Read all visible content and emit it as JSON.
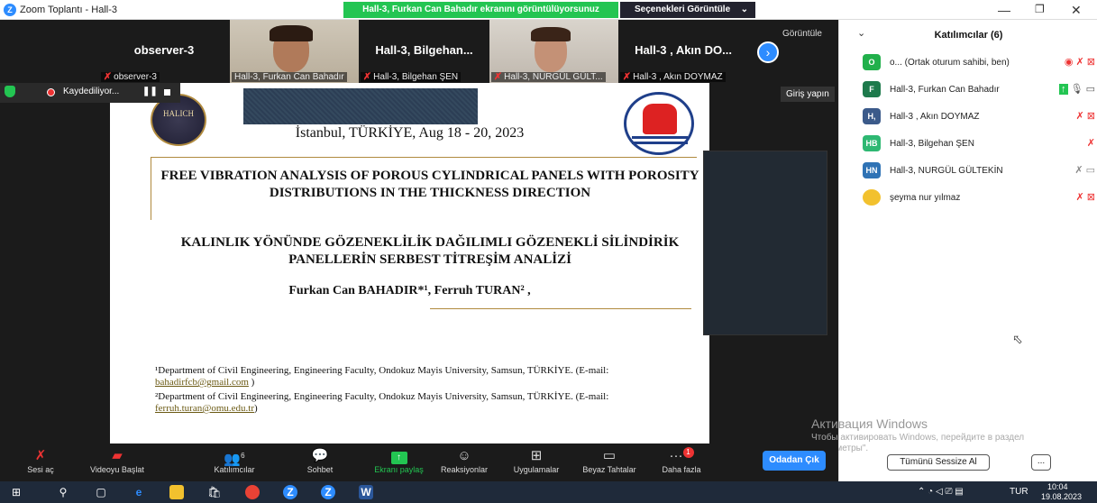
{
  "window": {
    "title": "Zoom Toplantı - Hall-3"
  },
  "share_banner": "Hall-3, Furkan Can Bahadır ekranını görüntülüyorsunuz",
  "view_options": "Seçenekleri Görüntüle",
  "thumbnails": [
    {
      "big": "observer-3",
      "small": "observer-3",
      "muted": true
    },
    {
      "big": "",
      "small": "Hall-3, Furkan Can Bahadır",
      "muted": false,
      "video": true
    },
    {
      "big": "Hall-3,  Bilgehan...",
      "small": "Hall-3, Bilgehan ŞEN",
      "muted": true
    },
    {
      "big": "",
      "small": "Hall-3, NURGÜL GÜLT...",
      "muted": true,
      "video": true
    },
    {
      "big": "Hall-3 , Akın DO...",
      "small": "Hall-3 , Akın DOYMAZ",
      "muted": true
    }
  ],
  "goruntule_label": "Görüntüle",
  "recording": "Kaydediliyor...",
  "giris": "Giriş yapın",
  "slide": {
    "logo_text": "HALICH",
    "location": "İstanbul, TÜRKİYE, Aug 18 - 20, 2023",
    "title_en": "FREE VIBRATION ANALYSIS OF POROUS CYLINDRICAL PANELS WITH POROSITY DISTRIBUTIONS IN THE THICKNESS DIRECTION",
    "title_tr": "KALINLIK YÖNÜNDE GÖZENEKLİLİK DAĞILIMLI GÖZENEKLİ SİLİNDİRİK PANELLERİN SERBEST TİTREŞİM ANALİZİ",
    "authors": "Furkan Can BAHADIR*¹, Ferruh TURAN² ,",
    "aff1": "¹Department of Civil Engineering, Engineering Faculty, Ondokuz Mayis University, Samsun, TÜRKİYE. (E-mail: ",
    "aff1_email": "bahadirfcb@gmail.com",
    "aff1_end": " )",
    "aff2": "²Department of Civil Engineering, Engineering Faculty, Ondokuz Mayis University, Samsun, TÜRKİYE. (E-mail: ",
    "aff2_email": "ferruh.turan@omu.edu.tr",
    "aff2_end": ")"
  },
  "panel": {
    "title": "Katılımcılar (6)",
    "participants": [
      {
        "initials": "O",
        "color": "#21b04b",
        "name": "o... (Ortak oturum sahibi, ben)"
      },
      {
        "initials": "F",
        "color": "#1e7a4c",
        "name": "Hall-3, Furkan Can Bahadır"
      },
      {
        "initials": "H,",
        "color": "#3b5a8a",
        "name": "Hall-3 , Akın DOYMAZ"
      },
      {
        "initials": "HB",
        "color": "#2eb872",
        "name": "Hall-3, Bilgehan ŞEN"
      },
      {
        "initials": "HN",
        "color": "#2f73b5",
        "name": "Hall-3, NURGÜL GÜLTEKİN"
      },
      {
        "initials": "",
        "color": "#f2c12e",
        "name": "şeyma nur yılmaz"
      }
    ],
    "mute_all": "Tümünü Sessize Al",
    "more": "..."
  },
  "watermark": {
    "line1": "Активация Windows",
    "line2": "Чтобы активировать Windows, перейдите в раздел \"Параметры\"."
  },
  "toolbar": {
    "audio": "Sesi aç",
    "video": "Videoyu Başlat",
    "participants": "Katılımcılar",
    "participants_count": "6",
    "chat": "Sohbet",
    "share": "Ekranı paylaş",
    "reactions": "Reaksiyonlar",
    "apps": "Uygulamalar",
    "whiteboard": "Beyaz Tahtalar",
    "more": "Daha fazla",
    "more_badge": "1",
    "leave": "Odadan Çık"
  },
  "taskbar": {
    "lang": "TUR",
    "time": "10:04",
    "date": "19.08.2023"
  }
}
